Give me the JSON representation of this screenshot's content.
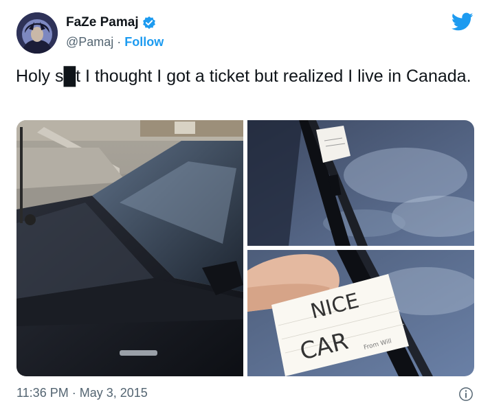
{
  "author": {
    "display_name": "FaZe Pamaj",
    "handle": "@Pamaj",
    "separator": "·",
    "follow_label": "Follow",
    "verified": true
  },
  "tweet": {
    "text": "Holy s█t I thought I got a ticket but realized I live in Canada.",
    "time": "11:36 PM",
    "separator": "·",
    "date": "May 3, 2015"
  },
  "media": {
    "photos": [
      {
        "description": "black car parked on street"
      },
      {
        "description": "paper note under windshield wiper"
      },
      {
        "description": "hand holding note"
      }
    ],
    "note_text_line1": "NICE",
    "note_text_line2": "CAR",
    "note_signature": "From Will"
  },
  "colors": {
    "accent": "#1d9bf0",
    "text": "#0f1419",
    "muted": "#536471"
  },
  "icons": {
    "brand": "twitter-bird-icon",
    "verified": "verified-badge-icon",
    "info": "info-icon"
  }
}
